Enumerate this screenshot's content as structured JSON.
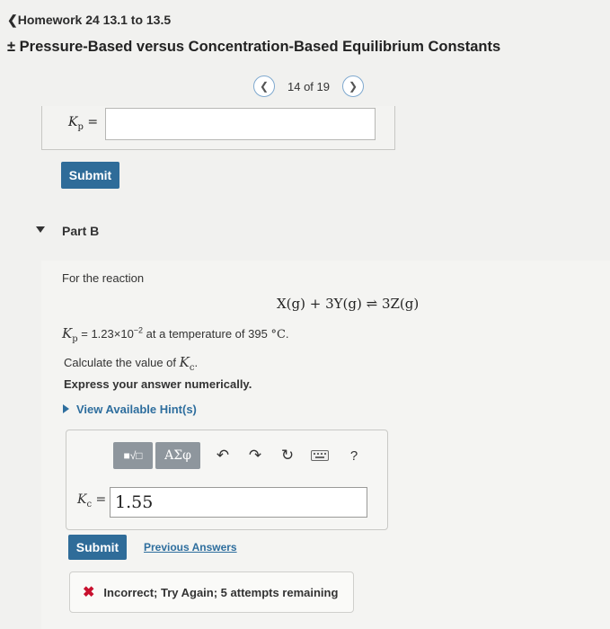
{
  "nav": {
    "back_label": "Homework 24 13.1 to 13.5"
  },
  "page": {
    "title": "Pressure-Based versus Concentration-Based Equilibrium Constants"
  },
  "pager": {
    "text": "14 of 19"
  },
  "part_a": {
    "kp_label": "Kp =",
    "kp_value": "",
    "submit_label": "Submit"
  },
  "part_b": {
    "label": "Part B",
    "intro": "For the reaction",
    "reaction": "X(g) + 3Y(g) ⇌ 3Z(g)",
    "kp_symbol": "Kp",
    "kp_value_text": " = 1.23×10",
    "kp_exponent": "−2",
    "temp_text": " at a temperature of 395 ",
    "temp_unit": "°C",
    "calc_text": "Calculate the value of ",
    "kc_symbol": "Kc",
    "express": "Express your answer numerically.",
    "hint_label": "View Available Hint(s)",
    "toolbar": {
      "template_glyph": "■√□",
      "greek_label": "ΑΣφ",
      "help_label": "?"
    },
    "kc_label": "Kc =",
    "kc_value": "1.55",
    "submit_label": "Submit",
    "previous_answers_label": "Previous Answers",
    "feedback": "Incorrect; Try Again; 5 attempts remaining"
  }
}
